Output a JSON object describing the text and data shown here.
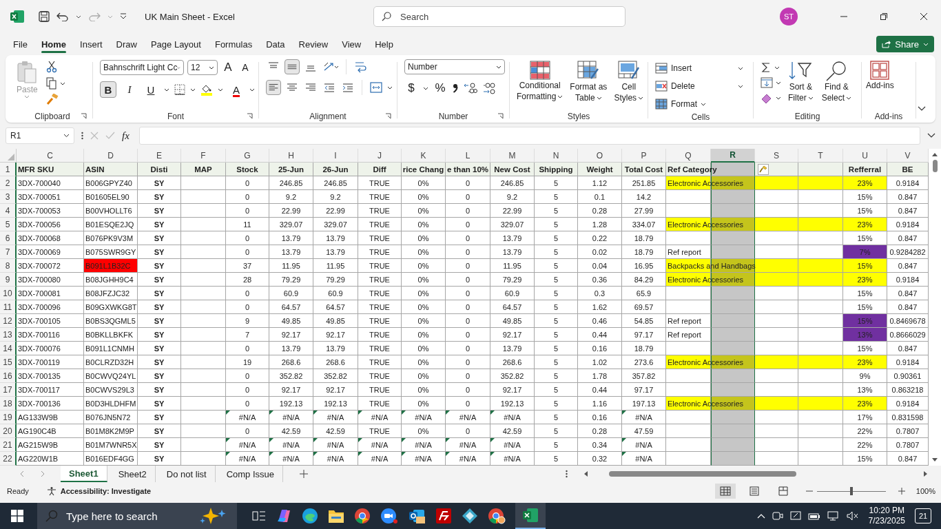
{
  "title_bar": {
    "title": "UK Main Sheet - Excel",
    "search_placeholder": "Search",
    "avatar": "ST"
  },
  "menu": [
    {
      "label": "File",
      "selected": false
    },
    {
      "label": "Home",
      "selected": true
    },
    {
      "label": "Insert",
      "selected": false
    },
    {
      "label": "Draw",
      "selected": false
    },
    {
      "label": "Page Layout",
      "selected": false
    },
    {
      "label": "Formulas",
      "selected": false
    },
    {
      "label": "Data",
      "selected": false
    },
    {
      "label": "Review",
      "selected": false
    },
    {
      "label": "View",
      "selected": false
    },
    {
      "label": "Help",
      "selected": false
    }
  ],
  "share_button": "Share",
  "ribbon": {
    "clipboard": {
      "label": "Clipboard",
      "paste": "Paste",
      "paste_disabled": true
    },
    "font": {
      "label": "Font",
      "font_name": "Bahnschrift Light Cc",
      "font_size": "12",
      "grow": "A",
      "shrink": "A",
      "bold": "B",
      "bold_on": true,
      "italic": "I",
      "underline": "U",
      "font_color": "A"
    },
    "alignment": {
      "label": "Alignment",
      "middle_on": true,
      "left_on": true
    },
    "number": {
      "label": "Number",
      "format": "Number",
      "currency": "$",
      "percent": "%"
    },
    "styles": {
      "label": "Styles",
      "buttons": [
        {
          "line1": "Conditional",
          "line2": "Formatting"
        },
        {
          "line1": "Format as",
          "line2": "Table"
        },
        {
          "line1": "Cell",
          "line2": "Styles"
        }
      ]
    },
    "cells": {
      "label": "Cells",
      "buttons": [
        "Insert",
        "Delete",
        "Format"
      ]
    },
    "editing": {
      "label": "Editing",
      "buttons": [
        {
          "line1": "Sort &",
          "line2": "Filter"
        },
        {
          "line1": "Find &",
          "line2": "Select"
        }
      ]
    },
    "addins": {
      "label": "Add-ins",
      "button": "Add-ins"
    }
  },
  "formula_bar": {
    "name_box": "R1",
    "function_label": "fx"
  },
  "header_row_number": "1",
  "columns": [
    {
      "letter": "C",
      "heading": "MFR SKU",
      "selected": false
    },
    {
      "letter": "D",
      "heading": "ASIN",
      "selected": false
    },
    {
      "letter": "E",
      "heading": "Disti",
      "selected": false
    },
    {
      "letter": "F",
      "heading": "MAP",
      "selected": false
    },
    {
      "letter": "G",
      "heading": "Stock",
      "selected": false
    },
    {
      "letter": "H",
      "heading": "25-Jun",
      "selected": false
    },
    {
      "letter": "I",
      "heading": "26-Jun",
      "selected": false
    },
    {
      "letter": "J",
      "heading": "Diff",
      "selected": false
    },
    {
      "letter": "K",
      "heading": "rice Chang",
      "selected": false
    },
    {
      "letter": "L",
      "heading": "e than 10%",
      "selected": false
    },
    {
      "letter": "M",
      "heading": "New Cost",
      "selected": false
    },
    {
      "letter": "N",
      "heading": "Shipping",
      "selected": false
    },
    {
      "letter": "O",
      "heading": "Weight",
      "selected": false
    },
    {
      "letter": "P",
      "heading": "Total Cost",
      "selected": false
    },
    {
      "letter": "Q",
      "heading": "Ref Category",
      "selected": false
    },
    {
      "letter": "R",
      "selected": true
    },
    {
      "letter": "S",
      "selected": false
    },
    {
      "letter": "T",
      "selected": false
    },
    {
      "letter": "U",
      "heading": "Refferral",
      "selected": false
    },
    {
      "letter": "V",
      "heading": "BE",
      "selected": false
    }
  ],
  "rows": [
    {
      "n": "2",
      "cells": [
        "3DX-700040",
        "B006GPYZ40",
        "SY",
        null,
        "0",
        "246.85",
        "246.85",
        "TRUE",
        "0%",
        "0",
        "246.85",
        "5",
        "1.12",
        "251.85",
        "Electronic Accessories",
        null,
        null,
        null,
        "23%",
        "0.9184"
      ],
      "category_highlight": true,
      "referral_alert": false,
      "asin_alert": false,
      "error_marks": false
    },
    {
      "n": "3",
      "cells": [
        "3DX-700051",
        "B01605EL90",
        "SY",
        null,
        "0",
        "9.2",
        "9.2",
        "TRUE",
        "0%",
        "0",
        "9.2",
        "5",
        "0.1",
        "14.2",
        null,
        null,
        null,
        null,
        "15%",
        "0.847"
      ],
      "category_highlight": false,
      "referral_alert": false,
      "asin_alert": false,
      "error_marks": false
    },
    {
      "n": "4",
      "cells": [
        "3DX-700053",
        "B00VHOLLT6",
        "SY",
        null,
        "0",
        "22.99",
        "22.99",
        "TRUE",
        "0%",
        "0",
        "22.99",
        "5",
        "0.28",
        "27.99",
        null,
        null,
        null,
        null,
        "15%",
        "0.847"
      ],
      "category_highlight": false,
      "referral_alert": false,
      "asin_alert": false,
      "error_marks": false
    },
    {
      "n": "5",
      "cells": [
        "3DX-700056",
        "B01ESQE2JQ",
        "SY",
        null,
        "11",
        "329.07",
        "329.07",
        "TRUE",
        "0%",
        "0",
        "329.07",
        "5",
        "1.28",
        "334.07",
        "Electronic Accessories",
        null,
        null,
        null,
        "23%",
        "0.9184"
      ],
      "category_highlight": true,
      "referral_alert": false,
      "asin_alert": false,
      "error_marks": false
    },
    {
      "n": "6",
      "cells": [
        "3DX-700068",
        "B076PK9V3M",
        "SY",
        null,
        "0",
        "13.79",
        "13.79",
        "TRUE",
        "0%",
        "0",
        "13.79",
        "5",
        "0.22",
        "18.79",
        null,
        null,
        null,
        null,
        "15%",
        "0.847"
      ],
      "category_highlight": false,
      "referral_alert": false,
      "asin_alert": false,
      "error_marks": false
    },
    {
      "n": "7",
      "cells": [
        "3DX-700069",
        "B075SWR9GY",
        "SY",
        null,
        "0",
        "13.79",
        "13.79",
        "TRUE",
        "0%",
        "0",
        "13.79",
        "5",
        "0.02",
        "18.79",
        "Ref report",
        null,
        null,
        null,
        "7%",
        "0.9284282"
      ],
      "category_highlight": false,
      "referral_alert": true,
      "asin_alert": false,
      "error_marks": false
    },
    {
      "n": "8",
      "cells": [
        "3DX-700072",
        "B091L1B32C",
        "SY",
        null,
        "37",
        "11.95",
        "11.95",
        "TRUE",
        "0%",
        "0",
        "11.95",
        "5",
        "0.04",
        "16.95",
        "Backpacks and Handbags",
        null,
        null,
        null,
        "15%",
        "0.847"
      ],
      "category_highlight": true,
      "referral_alert": false,
      "asin_alert": true,
      "error_marks": false
    },
    {
      "n": "9",
      "cells": [
        "3DX-700080",
        "B08JGHH9C4",
        "SY",
        null,
        "28",
        "79.29",
        "79.29",
        "TRUE",
        "0%",
        "0",
        "79.29",
        "5",
        "0.36",
        "84.29",
        "Electronic Accessories",
        null,
        null,
        null,
        "23%",
        "0.9184"
      ],
      "category_highlight": true,
      "referral_alert": false,
      "asin_alert": false,
      "error_marks": false
    },
    {
      "n": "10",
      "cells": [
        "3DX-700081",
        "B08JFZJC32",
        "SY",
        null,
        "0",
        "60.9",
        "60.9",
        "TRUE",
        "0%",
        "0",
        "60.9",
        "5",
        "0.3",
        "65.9",
        null,
        null,
        null,
        null,
        "15%",
        "0.847"
      ],
      "category_highlight": false,
      "referral_alert": false,
      "asin_alert": false,
      "error_marks": false
    },
    {
      "n": "11",
      "cells": [
        "3DX-700096",
        "B09GXWKG8T",
        "SY",
        null,
        "0",
        "64.57",
        "64.57",
        "TRUE",
        "0%",
        "0",
        "64.57",
        "5",
        "1.62",
        "69.57",
        null,
        null,
        null,
        null,
        "15%",
        "0.847"
      ],
      "category_highlight": false,
      "referral_alert": false,
      "asin_alert": false,
      "error_marks": false
    },
    {
      "n": "12",
      "cells": [
        "3DX-700105",
        "B0BS3QGML5",
        "SY",
        null,
        "9",
        "49.85",
        "49.85",
        "TRUE",
        "0%",
        "0",
        "49.85",
        "5",
        "0.46",
        "54.85",
        "Ref report",
        null,
        null,
        null,
        "15%",
        "0.8469678"
      ],
      "category_highlight": false,
      "referral_alert": true,
      "asin_alert": false,
      "error_marks": false
    },
    {
      "n": "13",
      "cells": [
        "3DX-700116",
        "B0BKLLBKFK",
        "SY",
        null,
        "7",
        "92.17",
        "92.17",
        "TRUE",
        "0%",
        "0",
        "92.17",
        "5",
        "0.44",
        "97.17",
        "Ref report",
        null,
        null,
        null,
        "13%",
        "0.8666029"
      ],
      "category_highlight": false,
      "referral_alert": true,
      "asin_alert": false,
      "error_marks": false
    },
    {
      "n": "14",
      "cells": [
        "3DX-700076",
        "B091L1CNMH",
        "SY",
        null,
        "0",
        "13.79",
        "13.79",
        "TRUE",
        "0%",
        "0",
        "13.79",
        "5",
        "0.16",
        "18.79",
        null,
        null,
        null,
        null,
        "15%",
        "0.847"
      ],
      "category_highlight": false,
      "referral_alert": false,
      "asin_alert": false,
      "error_marks": false
    },
    {
      "n": "15",
      "cells": [
        "3DX-700119",
        "B0CLRZD32H",
        "SY",
        null,
        "19",
        "268.6",
        "268.6",
        "TRUE",
        "0%",
        "0",
        "268.6",
        "5",
        "1.02",
        "273.6",
        "Electronic Accessories",
        null,
        null,
        null,
        "23%",
        "0.9184"
      ],
      "category_highlight": true,
      "referral_alert": false,
      "asin_alert": false,
      "error_marks": false
    },
    {
      "n": "16",
      "cells": [
        "3DX-700135",
        "B0CWVQ24YL",
        "SY",
        null,
        "0",
        "352.82",
        "352.82",
        "TRUE",
        "0%",
        "0",
        "352.82",
        "5",
        "1.78",
        "357.82",
        null,
        null,
        null,
        null,
        "9%",
        "0.90361"
      ],
      "category_highlight": false,
      "referral_alert": false,
      "asin_alert": false,
      "error_marks": false
    },
    {
      "n": "17",
      "cells": [
        "3DX-700117",
        "B0CWVS29L3",
        "SY",
        null,
        "0",
        "92.17",
        "92.17",
        "TRUE",
        "0%",
        "0",
        "92.17",
        "5",
        "0.44",
        "97.17",
        null,
        null,
        null,
        null,
        "13%",
        "0.863218"
      ],
      "category_highlight": false,
      "referral_alert": false,
      "asin_alert": false,
      "error_marks": false
    },
    {
      "n": "18",
      "cells": [
        "3DX-700136",
        "B0D3HLDHFM",
        "SY",
        null,
        "0",
        "192.13",
        "192.13",
        "TRUE",
        "0%",
        "0",
        "192.13",
        "5",
        "1.16",
        "197.13",
        "Electronic Accessories",
        null,
        null,
        null,
        "23%",
        "0.9184"
      ],
      "category_highlight": true,
      "referral_alert": false,
      "asin_alert": false,
      "error_marks": false
    },
    {
      "n": "19",
      "cells": [
        "AG133W9B",
        "B076JN5N72",
        "SY",
        null,
        "#N/A",
        "#N/A",
        "#N/A",
        "#N/A",
        "#N/A",
        "#N/A",
        "#N/A",
        "5",
        "0.16",
        "#N/A",
        null,
        null,
        null,
        null,
        "17%",
        "0.831598"
      ],
      "category_highlight": false,
      "referral_alert": false,
      "asin_alert": false,
      "error_marks": true
    },
    {
      "n": "20",
      "cells": [
        "AG190C4B",
        "B01M8K2M9P",
        "SY",
        null,
        "0",
        "42.59",
        "42.59",
        "TRUE",
        "0%",
        "0",
        "42.59",
        "5",
        "0.28",
        "47.59",
        null,
        null,
        null,
        null,
        "22%",
        "0.7807"
      ],
      "category_highlight": false,
      "referral_alert": false,
      "asin_alert": false,
      "error_marks": false
    },
    {
      "n": "21",
      "cells": [
        "AG215W9B",
        "B01M7WNR5X",
        "SY",
        null,
        "#N/A",
        "#N/A",
        "#N/A",
        "#N/A",
        "#N/A",
        "#N/A",
        "#N/A",
        "5",
        "0.34",
        "#N/A",
        null,
        null,
        null,
        null,
        "22%",
        "0.7807"
      ],
      "category_highlight": false,
      "referral_alert": false,
      "asin_alert": false,
      "error_marks": true
    },
    {
      "n": "22",
      "cells": [
        "AG220W1B",
        "B016EDF4GG",
        "SY",
        null,
        "#N/A",
        "#N/A",
        "#N/A",
        "#N/A",
        "#N/A",
        "#N/A",
        "#N/A",
        "5",
        "0.32",
        "#N/A",
        null,
        null,
        null,
        null,
        "15%",
        "0.847"
      ],
      "category_highlight": false,
      "referral_alert": false,
      "asin_alert": false,
      "error_marks": true
    }
  ],
  "sheet_tabs": [
    {
      "label": "Sheet1",
      "selected": true
    },
    {
      "label": "Sheet2",
      "selected": false
    },
    {
      "label": "Do not list",
      "selected": false
    },
    {
      "label": "Comp Issue",
      "selected": false
    }
  ],
  "status_bar": {
    "mode": "Ready",
    "accessibility": "Accessibility: Investigate",
    "views": [
      {
        "kind": "normal",
        "selected": true
      },
      {
        "kind": "page_layout",
        "selected": false
      },
      {
        "kind": "page_break",
        "selected": false
      }
    ],
    "zoom_slider": {
      "level": 0.5
    },
    "zoom": "100%"
  },
  "taskbar": {
    "search_placeholder": "Type here to search",
    "time": "10:20 PM",
    "date": "7/23/2025",
    "notifications": "21"
  }
}
